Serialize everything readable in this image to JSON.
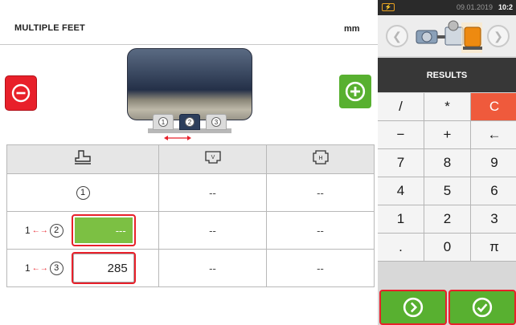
{
  "header": {
    "title": "MULTIPLE FEET",
    "unit": "mm"
  },
  "colors": {
    "accent_red": "#e8202a",
    "accent_green": "#58b030",
    "entry_green": "#7cc043",
    "panel_dark": "#373737"
  },
  "machine": {
    "feet": [
      {
        "label": "1"
      },
      {
        "label": "2"
      },
      {
        "label": "3"
      }
    ],
    "active_foot": 2
  },
  "table": {
    "header_icons": [
      "feet-position-icon",
      "vertical-offset-icon",
      "horizontal-offset-icon"
    ],
    "rows": [
      {
        "foot": "1",
        "from": "",
        "entry": "",
        "vertical": "--",
        "horizontal": "--"
      },
      {
        "foot": "2",
        "from": "1",
        "entry": "---",
        "vertical": "--",
        "horizontal": "--"
      },
      {
        "foot": "3",
        "from": "1",
        "entry": "285",
        "vertical": "--",
        "horizontal": "--"
      }
    ]
  },
  "status": {
    "battery_icon": "battery-icon",
    "date": "09.01.2019",
    "time": "10:2"
  },
  "panel": {
    "results_label": "RESULTS"
  },
  "keypad": {
    "keys": [
      "/",
      "*",
      "C",
      "−",
      "+",
      "←",
      "7",
      "8",
      "9",
      "4",
      "5",
      "6",
      "1",
      "2",
      "3",
      ".",
      "0",
      "π"
    ]
  },
  "footer": {
    "next_icon": "next-circle-icon",
    "confirm_icon": "check-circle-icon"
  }
}
